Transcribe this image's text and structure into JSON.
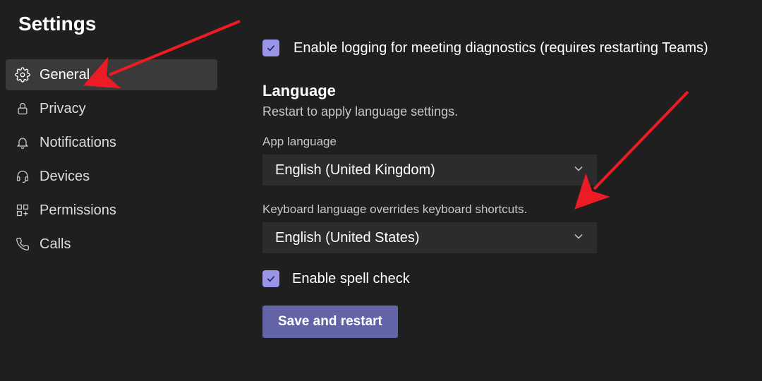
{
  "header": {
    "title": "Settings"
  },
  "sidebar": {
    "items": [
      {
        "label": "General",
        "icon": "gear-icon",
        "active": true
      },
      {
        "label": "Privacy",
        "icon": "lock-icon",
        "active": false
      },
      {
        "label": "Notifications",
        "icon": "bell-icon",
        "active": false
      },
      {
        "label": "Devices",
        "icon": "headset-icon",
        "active": false
      },
      {
        "label": "Permissions",
        "icon": "grid-icon",
        "active": false
      },
      {
        "label": "Calls",
        "icon": "phone-icon",
        "active": false
      }
    ]
  },
  "content": {
    "logging_checkbox": {
      "checked": true,
      "label": "Enable logging for meeting diagnostics (requires restarting Teams)"
    },
    "language": {
      "heading": "Language",
      "subtext": "Restart to apply language settings.",
      "app_language_label": "App language",
      "app_language_value": "English (United Kingdom)",
      "keyboard_label": "Keyboard language overrides keyboard shortcuts.",
      "keyboard_value": "English (United States)",
      "spellcheck": {
        "checked": true,
        "label": "Enable spell check"
      },
      "save_button": "Save and restart"
    }
  }
}
